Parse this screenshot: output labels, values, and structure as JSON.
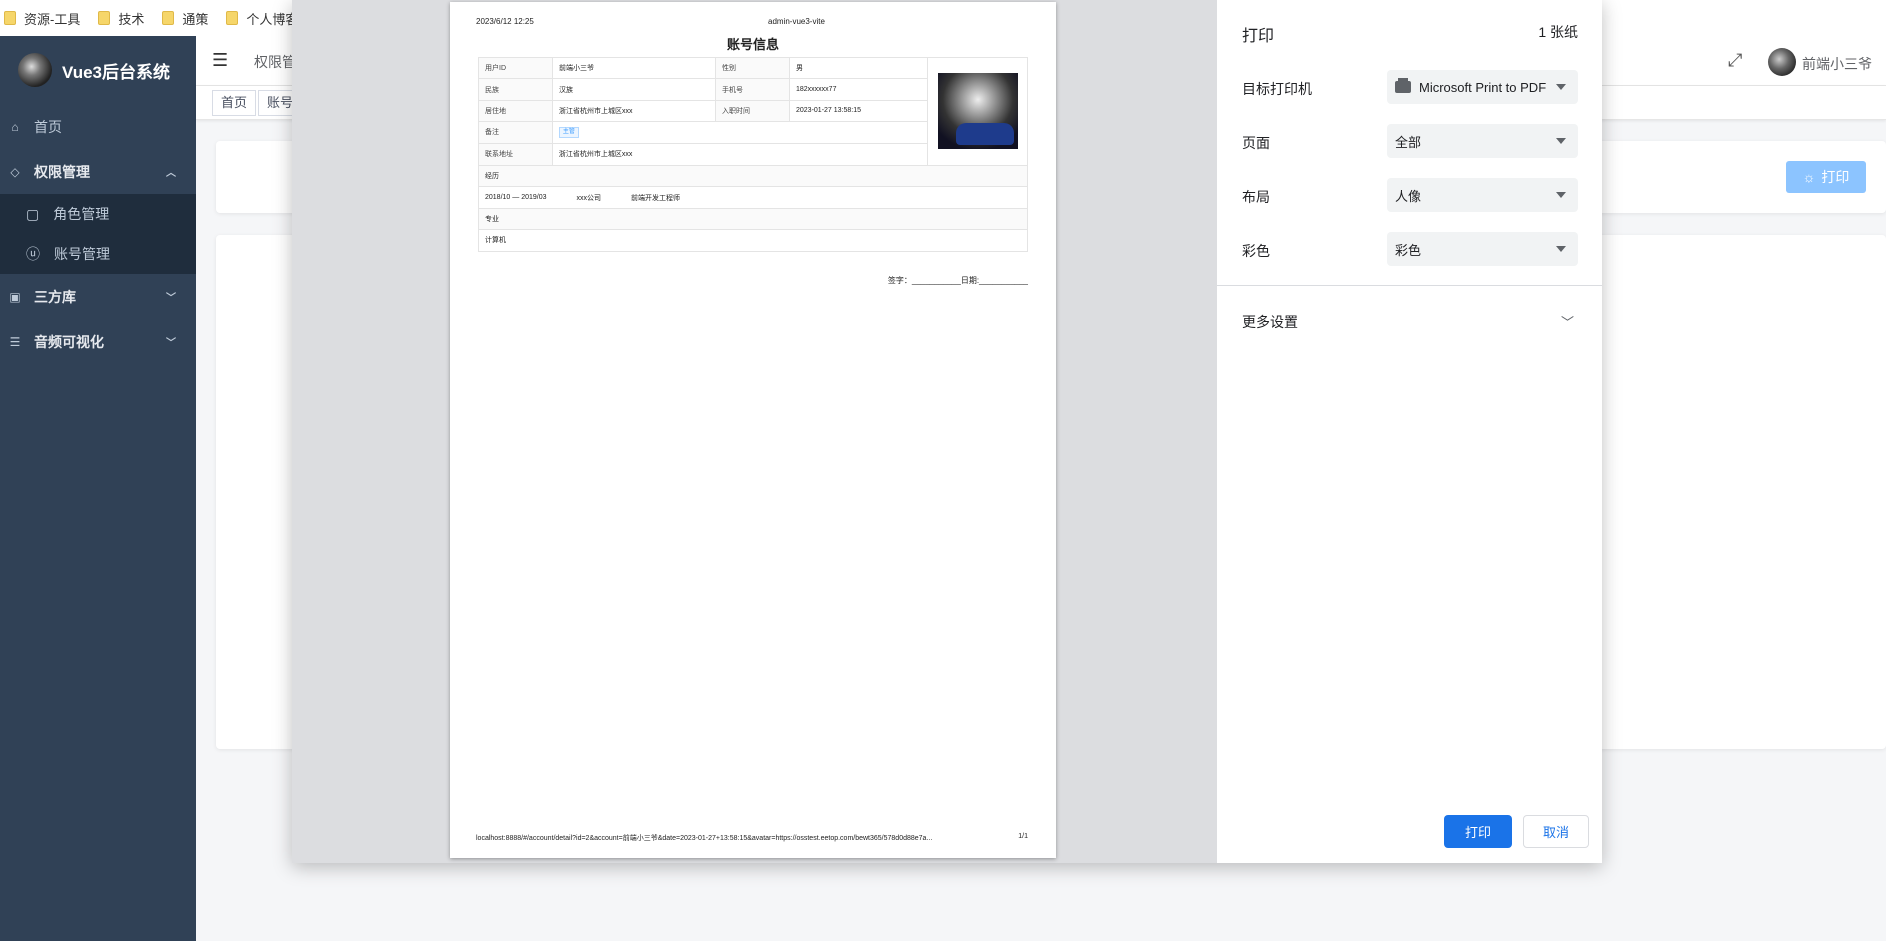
{
  "bookmarks": [
    "资源-工具",
    "技术",
    "通策",
    "个人博客"
  ],
  "sidebar": {
    "logo_text": "Vue3后台系统",
    "home": "首页",
    "permission": "权限管理",
    "role": "角色管理",
    "account": "账号管理",
    "third": "三方库",
    "audio": "音频可视化"
  },
  "navbar": {
    "breadcrumb": "权限管",
    "username": "前端小三爷"
  },
  "tags": [
    "首页",
    "账号"
  ],
  "page_print_button": "打印",
  "doc": {
    "date": "2023/6/12 12:25",
    "site": "admin-vue3-vite",
    "title": "账号信息",
    "labels": {
      "user_id": "用户ID",
      "gender": "性别",
      "nation": "民族",
      "phone": "手机号",
      "residence": "居住地",
      "join_time": "入职时间",
      "remark": "备注",
      "address": "联系地址",
      "experience": "经历",
      "major": "专业"
    },
    "values": {
      "user_id": "前端小三爷",
      "gender": "男",
      "nation": "汉族",
      "phone": "182xxxxxx77",
      "residence": "浙江省杭州市上城区xxx",
      "join_time": "2023-01-27 13:58:15",
      "remark_tag": "主管",
      "address": "浙江省杭州市上城区xxx"
    },
    "experience": {
      "period": "2018/10 — 2019/03",
      "company": "xxx公司",
      "role": "前端开发工程师"
    },
    "major_value": "计算机",
    "sign": "签字：___________日期:___________",
    "url": "localhost:8888/#/account/detail?id=2&account=前端小三爷&date=2023-01-27+13:58:15&avatar=https://osstest.eetop.com/bewt365/578d0d88e7a...",
    "page_no": "1/1"
  },
  "print": {
    "title": "打印",
    "sheets": "1 张纸",
    "destination_label": "目标打印机",
    "destination_value": "Microsoft Print to PDF",
    "pages_label": "页面",
    "pages_value": "全部",
    "layout_label": "布局",
    "layout_value": "人像",
    "color_label": "彩色",
    "color_value": "彩色",
    "more_settings": "更多设置",
    "print_button": "打印",
    "cancel_button": "取消"
  },
  "colors": {
    "sidebar_bg": "#304156",
    "primary": "#1a73e8",
    "page_button": "#8cc4ff"
  }
}
